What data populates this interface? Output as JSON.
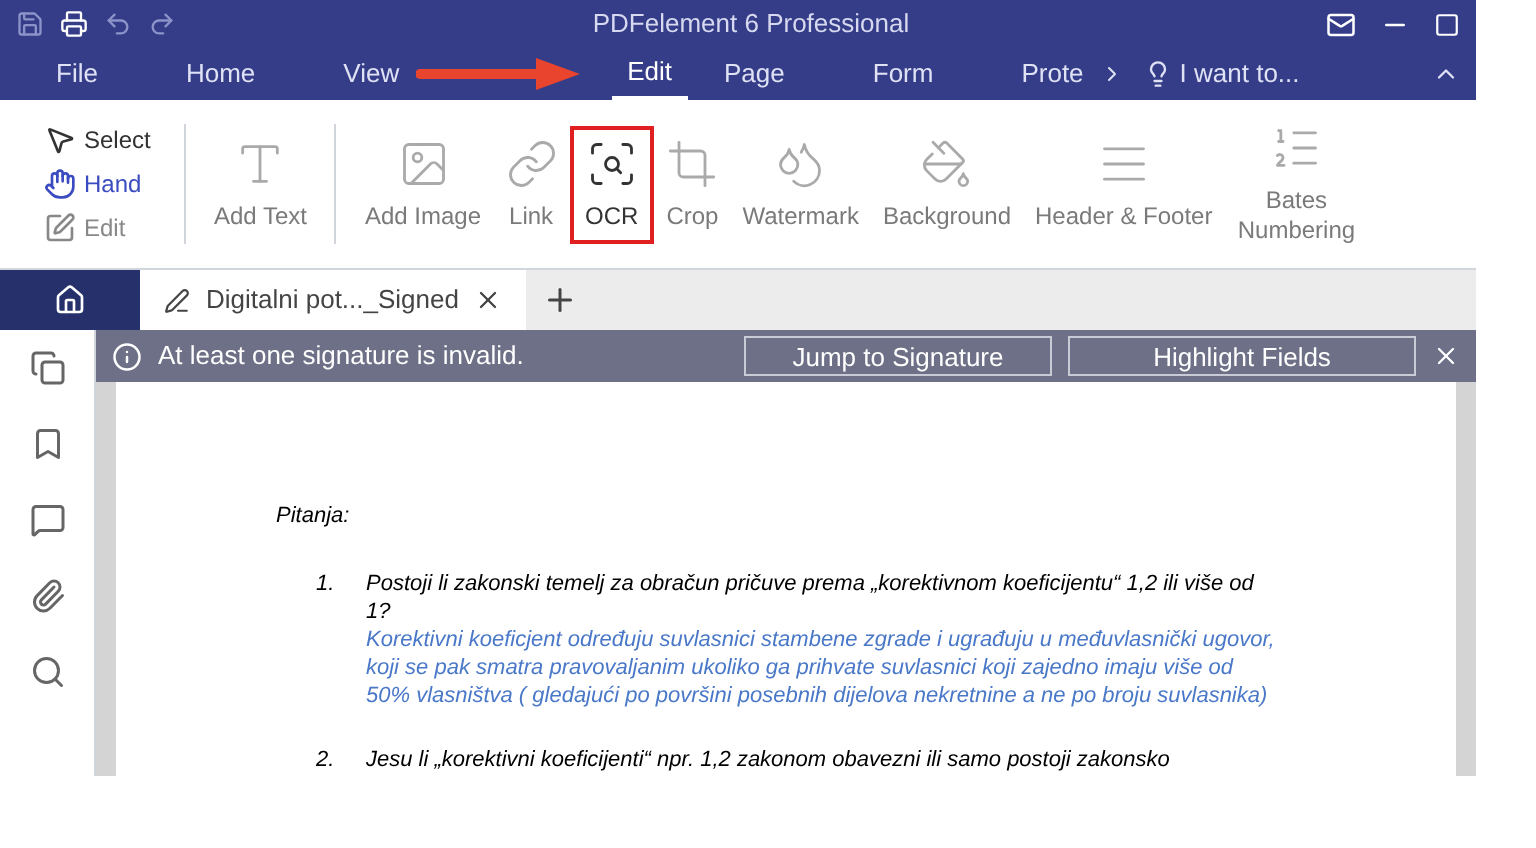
{
  "window": {
    "title": "PDFelement 6 Professional"
  },
  "menu_tabs": [
    {
      "label": "File",
      "selected": false
    },
    {
      "label": "Home",
      "selected": false
    },
    {
      "label": "View",
      "selected": false
    },
    {
      "label": "Edit",
      "selected": true
    },
    {
      "label": "Page",
      "selected": false
    },
    {
      "label": "Form",
      "selected": false
    },
    {
      "label": "Prote",
      "selected": false
    }
  ],
  "tell_me": "I want to...",
  "modes": [
    {
      "label": "Select",
      "selected": false
    },
    {
      "label": "Hand",
      "selected": true
    },
    {
      "label": "Edit",
      "selected": false
    }
  ],
  "tools": [
    {
      "label": "Add Text",
      "kind": "text",
      "highlighted": false
    },
    {
      "label": "Add Image",
      "kind": "image",
      "highlighted": false
    },
    {
      "label": "Link",
      "kind": "link",
      "highlighted": false
    },
    {
      "label": "OCR",
      "kind": "ocr",
      "highlighted": true
    },
    {
      "label": "Crop",
      "kind": "crop",
      "highlighted": false
    },
    {
      "label": "Watermark",
      "kind": "watermark",
      "highlighted": false
    },
    {
      "label": "Background",
      "kind": "background",
      "highlighted": false
    },
    {
      "label": "Header & Footer",
      "kind": "header",
      "highlighted": false
    },
    {
      "label": "Bates Numbering",
      "kind": "bates",
      "highlighted": false
    }
  ],
  "document_tab": {
    "label": "Digitalni pot..._Signed"
  },
  "notification": {
    "message": "At least one signature is invalid.",
    "buttons": [
      "Jump to Signature",
      "Highlight Fields"
    ]
  },
  "document": {
    "heading": "Pitanja:",
    "items": [
      {
        "number": "1.",
        "question": "Postoji li zakonski temelj za obračun pričuve prema „korektivnom koeficijentu“ 1,2 ili više od 1?",
        "answer": "Korektivni koeficjent određuju suvlasnici stambene zgrade i ugrađuju u međuvlasnički ugovor, koji se pak smatra pravovaljanim ukoliko ga prihvate suvlasnici koji zajedno imaju više od 50% vlasništva ( gledajući po površini posebnih dijelova nekretnine a ne po broju suvlasnika)"
      },
      {
        "number": "2.",
        "question": "Jesu li „korektivni koeficijenti“ npr. 1,2 zakonom obavezni ili samo postoji zakonsko"
      }
    ]
  }
}
